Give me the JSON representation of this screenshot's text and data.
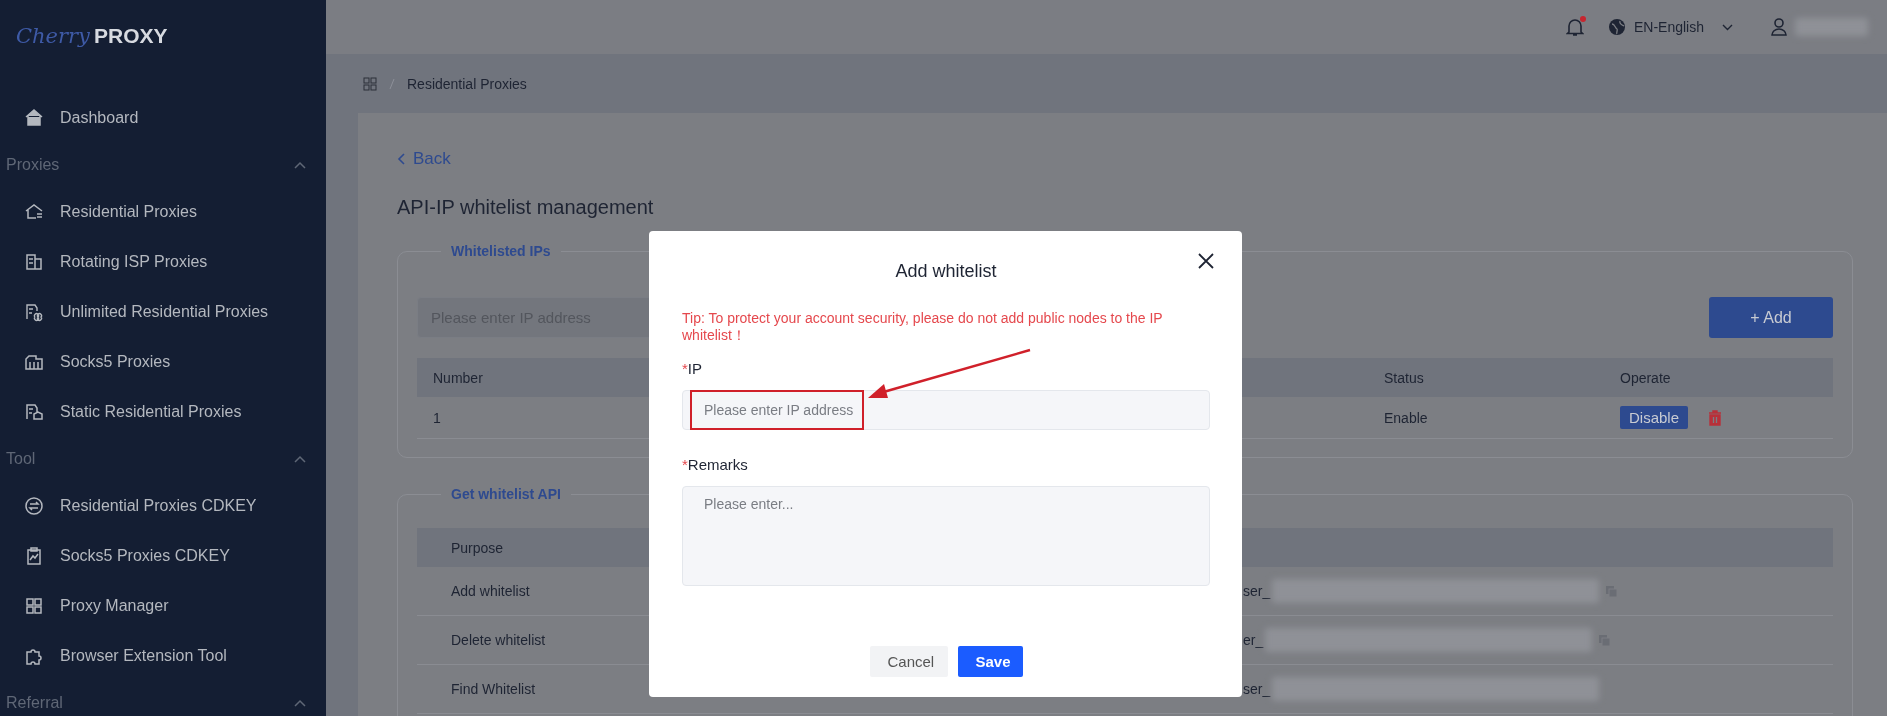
{
  "logo": {
    "brand": "Cherry",
    "suffix": "PROXY"
  },
  "sidebar": {
    "items": [
      {
        "kind": "link",
        "label": "Dashboard",
        "selected": false
      },
      {
        "kind": "group",
        "label": "Proxies",
        "expanded": true,
        "children": [
          {
            "kind": "link",
            "label": "Residential Proxies",
            "selected": false
          },
          {
            "kind": "link",
            "label": "Rotating ISP Proxies",
            "selected": false
          },
          {
            "kind": "link",
            "label": "Unlimited Residential Proxies",
            "selected": false
          },
          {
            "kind": "link",
            "label": "Socks5 Proxies",
            "selected": false
          },
          {
            "kind": "link",
            "label": "Static Residential Proxies",
            "selected": false
          }
        ]
      },
      {
        "kind": "group",
        "label": "Tool",
        "expanded": true,
        "children": [
          {
            "kind": "link",
            "label": "Residential Proxies CDKEY",
            "selected": false
          },
          {
            "kind": "link",
            "label": "Socks5 Proxies CDKEY",
            "selected": false
          },
          {
            "kind": "link",
            "label": "Proxy Manager",
            "selected": false
          },
          {
            "kind": "link",
            "label": "Browser Extension Tool",
            "selected": false
          }
        ]
      },
      {
        "kind": "group",
        "label": "Referral",
        "expanded": true
      }
    ]
  },
  "topbar": {
    "notification_dot": true,
    "language": "EN-English"
  },
  "breadcrumb": [
    "Residential Proxies"
  ],
  "back_link": "Back",
  "page_title": "API-IP whitelist management",
  "whitelisted_ips": {
    "legend": "Whitelisted IPs",
    "search": {
      "placeholder": "Please enter IP address"
    },
    "add_button": "+ Add",
    "columns": [
      "Number",
      "Status",
      "Operate"
    ],
    "rows": [
      {
        "number": "1",
        "status": "Enable",
        "action": "Disable"
      }
    ]
  },
  "whitelist_api": {
    "legend": "Get whitelist API",
    "columns": [
      "Purpose"
    ],
    "rows": [
      {
        "purpose": "Add whitelist",
        "column_2": "ser_",
        "copyable": true
      },
      {
        "purpose": "Delete whitelist",
        "column_2": "er_",
        "copyable": true
      },
      {
        "purpose": "Find Whitelist",
        "column_2": "ser_",
        "copyable": false
      }
    ]
  },
  "modal": {
    "title": "Add whitelist",
    "tip": "Tip: To protect your account security, please do not add public nodes to the IP whitelist！",
    "fields": [
      {
        "kind": "input",
        "required_mark": "*",
        "label": "IP",
        "placeholder": "Please enter IP address",
        "highlighted": true
      },
      {
        "kind": "textarea",
        "required_mark": "*",
        "label": "Remarks",
        "placeholder": "Please enter...",
        "highlighted": false
      }
    ],
    "buttons": [
      {
        "label": "Cancel",
        "primary": false
      },
      {
        "label": "Save",
        "primary": true
      }
    ]
  }
}
